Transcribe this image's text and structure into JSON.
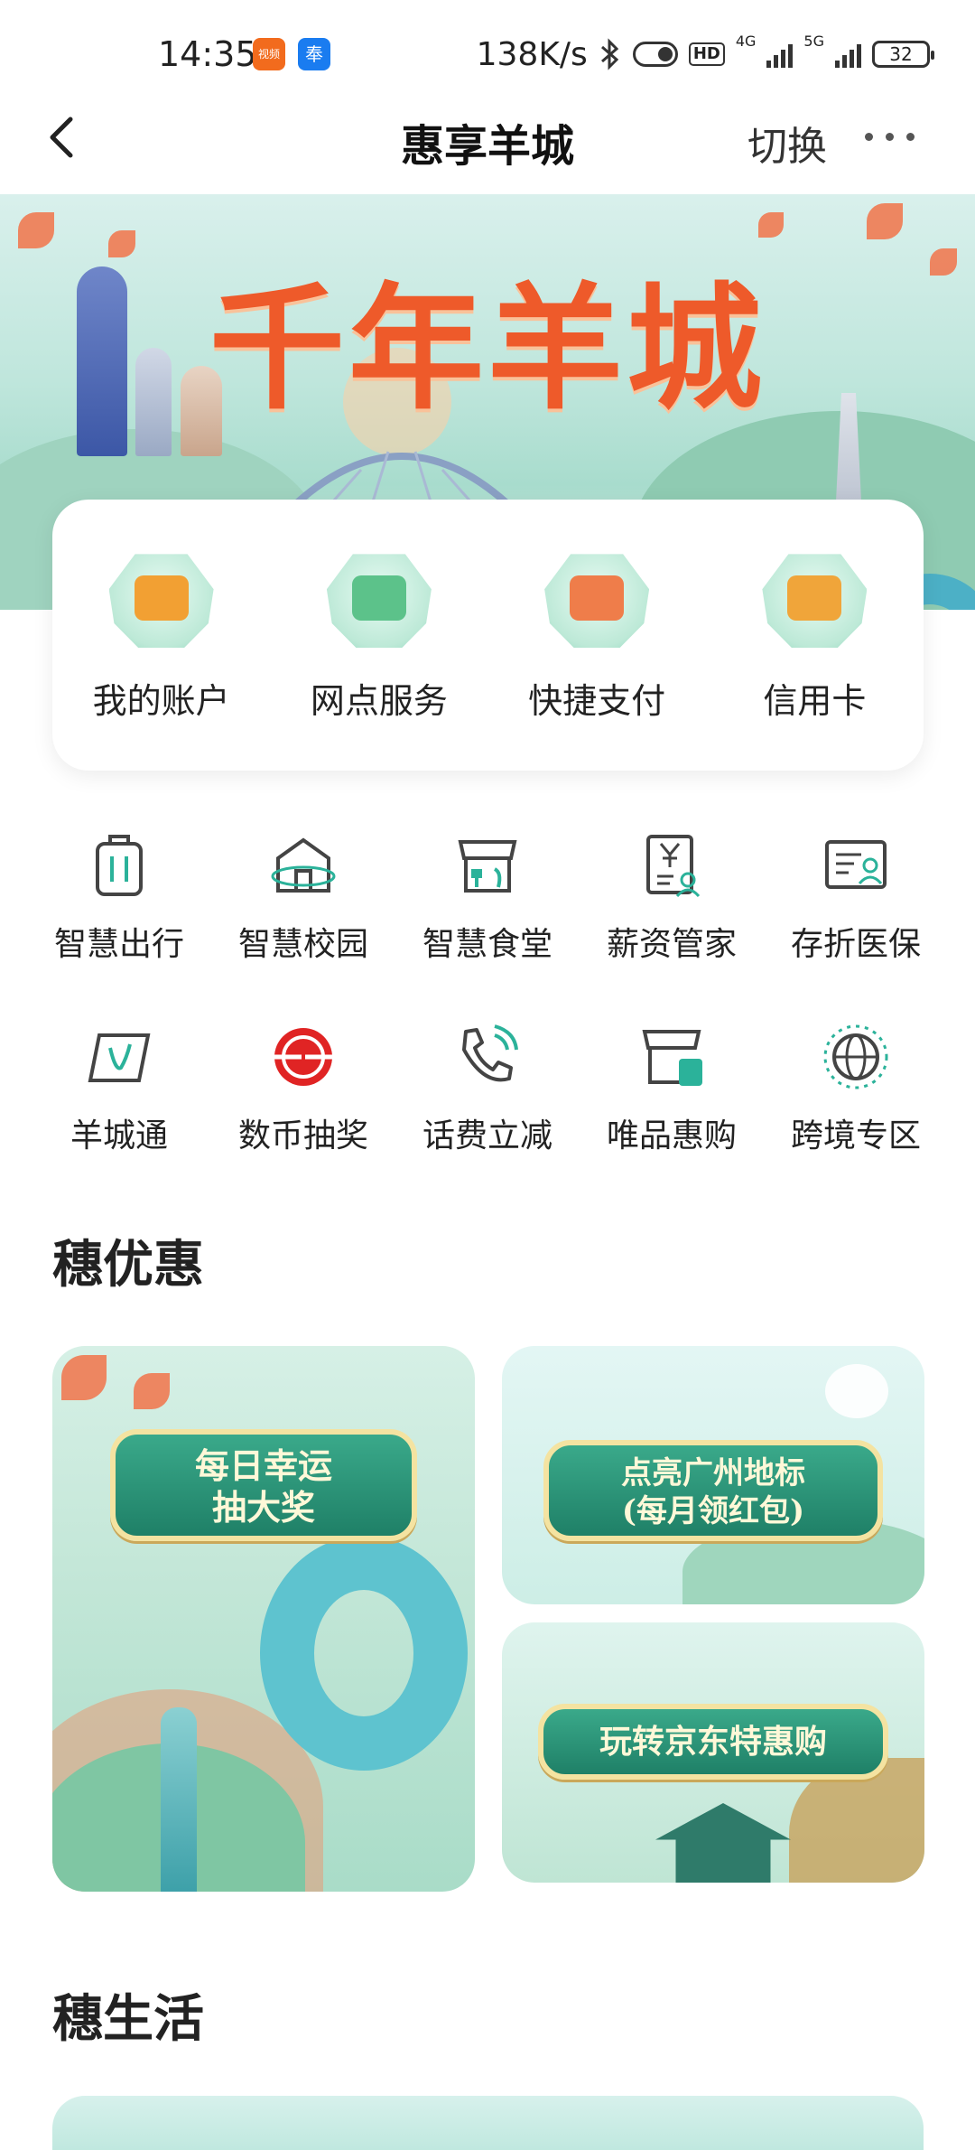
{
  "status_bar": {
    "time": "14:35",
    "network_speed": "138K/s",
    "hd_badge": "HD",
    "net_4g": "4G",
    "net_5g": "5G",
    "battery": "32",
    "app_badges": [
      "视频",
      "奉"
    ]
  },
  "nav": {
    "title": "惠享羊城",
    "switch_label": "切换",
    "back_icon": "chevron-left-icon",
    "more_icon": "more-dots-icon"
  },
  "banner": {
    "title": "千年羊城"
  },
  "quick_services": [
    {
      "label": "我的账户",
      "icon": "wallet-icon",
      "color": "#f2a033"
    },
    {
      "label": "网点服务",
      "icon": "bank-counter-icon",
      "color": "#5cc28a"
    },
    {
      "label": "快捷支付",
      "icon": "receipt-icon",
      "color": "#ef7d4a"
    },
    {
      "label": "信用卡",
      "icon": "card-envelope-icon",
      "color": "#f0a53a"
    }
  ],
  "grid_services": [
    [
      {
        "label": "智慧出行",
        "icon": "luggage-icon"
      },
      {
        "label": "智慧校园",
        "icon": "school-icon"
      },
      {
        "label": "智慧食堂",
        "icon": "canteen-icon"
      },
      {
        "label": "薪资管家",
        "icon": "salary-doc-icon"
      },
      {
        "label": "存折医保",
        "icon": "medical-card-icon"
      }
    ],
    [
      {
        "label": "羊城通",
        "icon": "yct-card-icon"
      },
      {
        "label": "数币抽奖",
        "icon": "ecny-icon"
      },
      {
        "label": "话费立减",
        "icon": "phone-icon"
      },
      {
        "label": "唯品惠购",
        "icon": "vip-store-icon"
      },
      {
        "label": "跨境专区",
        "icon": "globe-icon"
      }
    ]
  ],
  "sections": {
    "promo_title": "穗优惠",
    "life_title": "穗生活"
  },
  "promos": {
    "big": {
      "line1": "每日幸运",
      "line2": "抽大奖"
    },
    "top_right": {
      "line1": "点亮广州地标",
      "line2": "(每月领红包)"
    },
    "bottom_right": {
      "line1": "玩转京东特惠购"
    }
  },
  "colors": {
    "accent_green": "#2fa37f",
    "ecny_red": "#e02424",
    "icon_stroke": "#444444",
    "icon_teal": "#2bb29a"
  }
}
